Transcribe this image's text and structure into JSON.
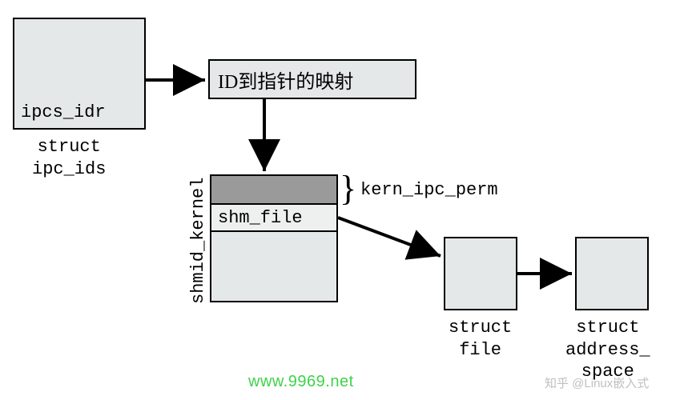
{
  "boxes": {
    "ipcs_idr": {
      "field": "ipcs_idr",
      "caption": "struct\nipc_ids"
    },
    "mapping": {
      "text": "ID到指针的映射"
    },
    "shmid_kernel": {
      "field": "shm_file",
      "side_label": "shmid_kernel",
      "brace_label": "kern_ipc_perm"
    },
    "struct_file": {
      "caption": "struct\nfile"
    },
    "struct_address_space": {
      "caption": "struct\naddress_\nspace"
    }
  },
  "watermarks": {
    "green": "www.9969.net",
    "gray": "知乎 @Linux嵌入式"
  }
}
